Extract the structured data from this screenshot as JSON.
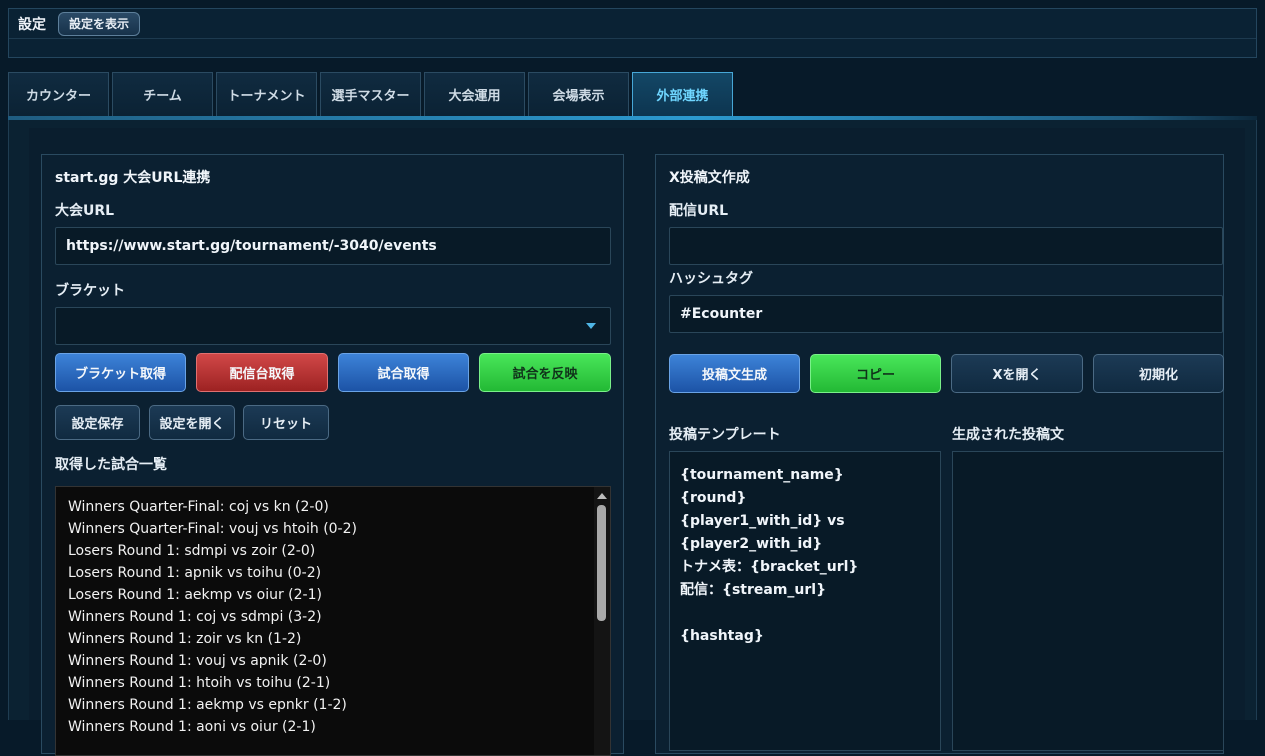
{
  "topbar": {
    "title": "設定",
    "show_settings_label": "設定を表示"
  },
  "tabs": [
    {
      "label": "カウンター",
      "active": false
    },
    {
      "label": "チーム",
      "active": false
    },
    {
      "label": "トーナメント",
      "active": false
    },
    {
      "label": "選手マスター",
      "active": false
    },
    {
      "label": "大会運用",
      "active": false
    },
    {
      "label": "会場表示",
      "active": false
    },
    {
      "label": "外部連携",
      "active": true
    }
  ],
  "left_panel": {
    "title": "start.gg 大会URL連携",
    "url_label": "大会URL",
    "url_value": "https://www.start.gg/tournament/-3040/events",
    "bracket_label": "ブラケット",
    "bracket_value": "",
    "buttons": {
      "fetch_bracket": "ブラケット取得",
      "fetch_stream": "配信台取得",
      "fetch_matches": "試合取得",
      "apply_match": "試合を反映",
      "save_settings": "設定保存",
      "open_settings": "設定を開く",
      "reset": "リセット"
    },
    "list_label": "取得した試合一覧",
    "matches": [
      "Winners Quarter-Final: coj vs kn (2-0)",
      "Winners Quarter-Final: vouj vs htoih (0-2)",
      "Losers Round 1: sdmpi vs zoir (2-0)",
      "Losers Round 1: apnik vs toihu (0-2)",
      "Losers Round 1: aekmp vs oiur (2-1)",
      "Winners Round 1: coj vs sdmpi (3-2)",
      "Winners Round 1: zoir vs kn (1-2)",
      "Winners Round 1: vouj vs apnik (2-0)",
      "Winners Round 1: htoih vs toihu (2-1)",
      "Winners Round 1: aekmp vs epnkr (1-2)",
      "Winners Round 1: aoni vs oiur (2-1)"
    ]
  },
  "right_panel": {
    "title": "X投稿文作成",
    "stream_url_label": "配信URL",
    "stream_url_value": "",
    "hashtag_label": "ハッシュタグ",
    "hashtag_value": "#Ecounter",
    "buttons": {
      "generate": "投稿文生成",
      "copy": "コピー",
      "open_x": "Xを開く",
      "init": "初期化"
    },
    "template_label": "投稿テンプレート",
    "template_text": "{tournament_name}\n{round}\n{player1_with_id} vs\n{player2_with_id}\nトナメ表：{bracket_url}\n配信：{stream_url}\n\n{hashtag}",
    "generated_label": "生成された投稿文",
    "generated_text": ""
  }
}
